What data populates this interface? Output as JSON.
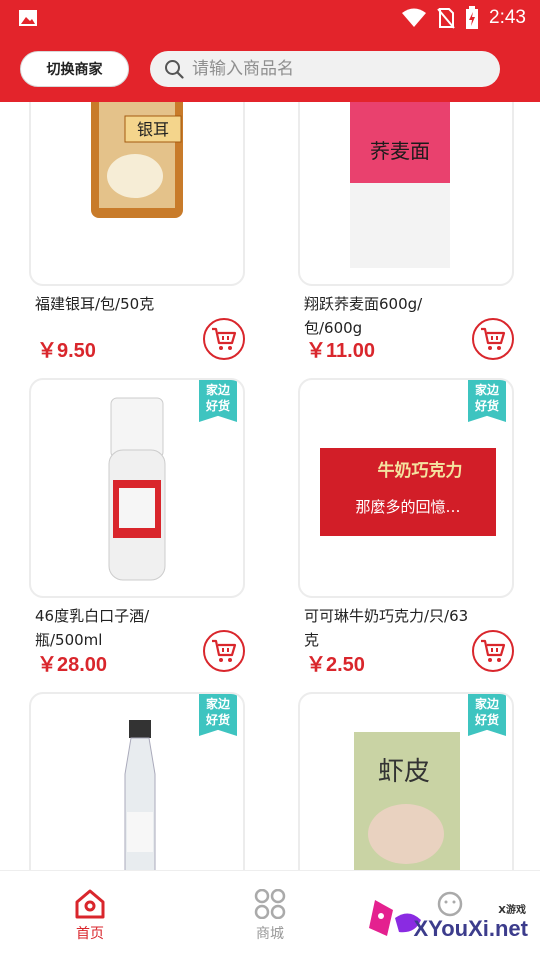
{
  "status_bar": {
    "time": "2:43"
  },
  "header": {
    "switch_label": "切换商家",
    "search_placeholder": "请输入商品名"
  },
  "badge": {
    "line1": "家边",
    "line2": "好货"
  },
  "products": [
    {
      "name": "福建银耳/包/50克",
      "price": "￥9.50"
    },
    {
      "name": "翔跃荞麦面600g/包/600g",
      "price": "￥11.00"
    },
    {
      "name": "46度乳白口子酒/瓶/500ml",
      "price": "￥28.00"
    },
    {
      "name": "可可琳牛奶巧克力/只/63克",
      "price": "￥2.50"
    },
    {
      "name": "",
      "price": ""
    },
    {
      "name": "",
      "price": ""
    }
  ],
  "product_images": {
    "p1": {
      "label": "银耳"
    },
    "p2": {
      "label": "荞麦面"
    },
    "p4": {
      "label": "牛奶巧克力",
      "sub": "那麼多的回憶…"
    },
    "p6": {
      "label": "虾皮"
    }
  },
  "tabs": [
    {
      "label": "首页",
      "icon": "home-icon",
      "active": true
    },
    {
      "label": "商城",
      "icon": "grid-icon",
      "active": false
    },
    {
      "label": "",
      "icon": "smile-icon",
      "active": false
    }
  ],
  "watermark": {
    "site": "XYouXi.net",
    "small": "X游戏"
  },
  "colors": {
    "brand_red": "#e3242b",
    "price_red": "#d9262c",
    "badge_teal": "#3ec4c0"
  }
}
